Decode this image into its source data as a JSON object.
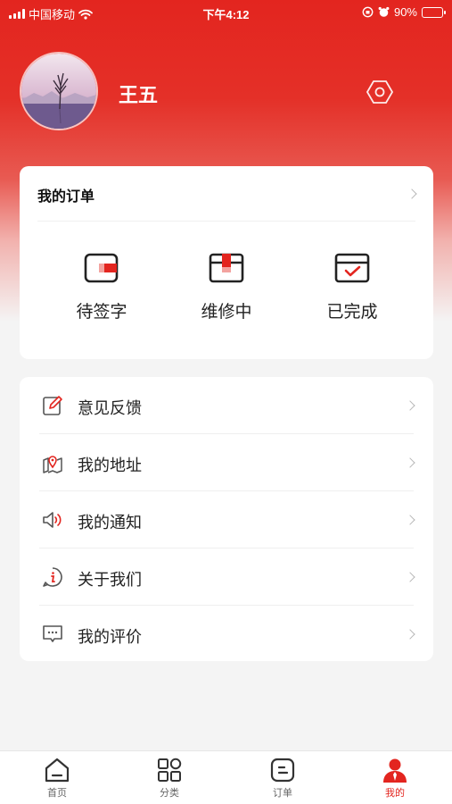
{
  "status_bar": {
    "carrier": "中国移动",
    "time": "下午4:12",
    "battery": "90%",
    "battery_level": 0.9
  },
  "profile": {
    "name": "王五"
  },
  "orders": {
    "title": "我的订单",
    "items": [
      {
        "label": "待签字",
        "icon": "wallet-sign-icon"
      },
      {
        "label": "维修中",
        "icon": "repair-box-icon"
      },
      {
        "label": "已完成",
        "icon": "completed-box-icon"
      }
    ]
  },
  "menu": {
    "items": [
      {
        "label": "意见反馈",
        "icon": "feedback-edit-icon"
      },
      {
        "label": "我的地址",
        "icon": "map-location-icon"
      },
      {
        "label": "我的通知",
        "icon": "speaker-icon"
      },
      {
        "label": "关于我们",
        "icon": "info-icon"
      },
      {
        "label": "我的评价",
        "icon": "comment-icon"
      }
    ]
  },
  "tabbar": {
    "items": [
      {
        "label": "首页",
        "icon": "home-icon"
      },
      {
        "label": "分类",
        "icon": "category-grid-icon"
      },
      {
        "label": "订单",
        "icon": "order-icon"
      },
      {
        "label": "我的",
        "icon": "user-icon"
      }
    ],
    "active": "我的"
  },
  "colors": {
    "accent": "#e3251f",
    "background": "#f4f4f4"
  }
}
